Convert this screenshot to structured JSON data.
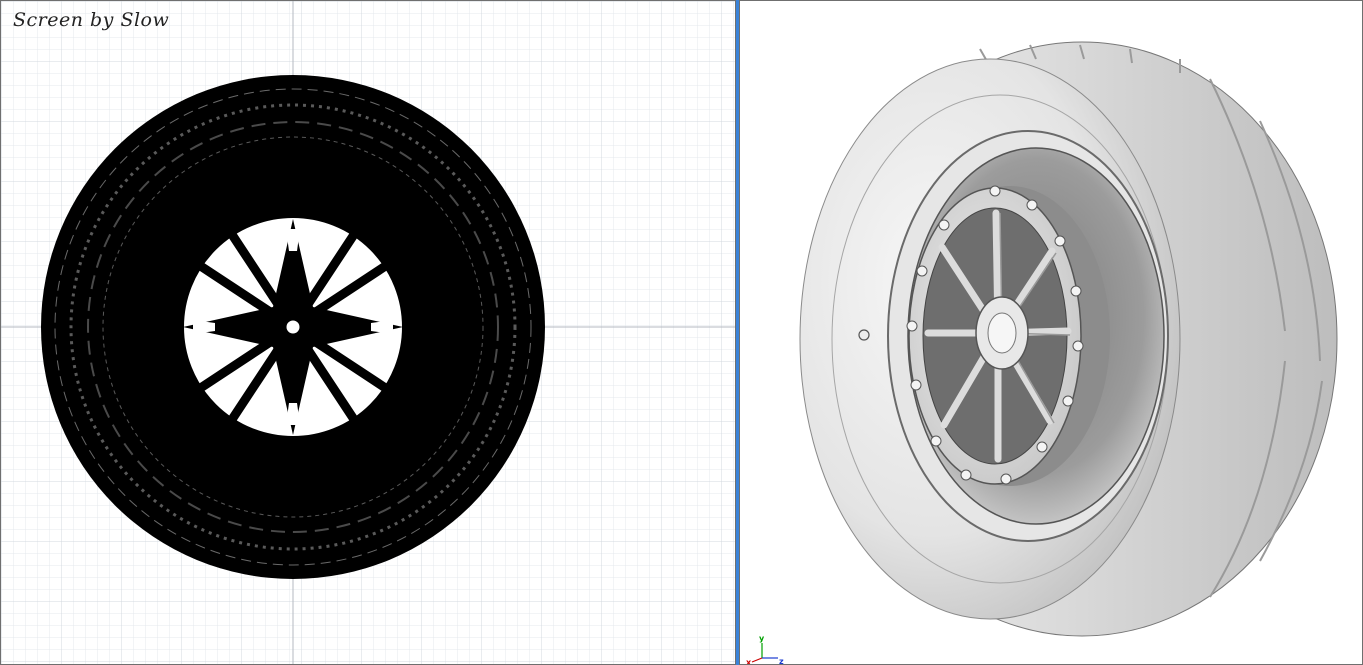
{
  "viewports": {
    "left": {
      "mode": "wireframe",
      "watermark": "Screen by Slow",
      "grid": true
    },
    "right": {
      "mode": "shaded"
    }
  },
  "axis_gizmo": {
    "x": "x",
    "y": "y",
    "z": "z"
  },
  "colors": {
    "grid_minor": "#e4e8ee",
    "grid_major": "#c9ced6",
    "wireframe": "#000000",
    "splitter": "#3a83d9",
    "axis_x": "#cc0000",
    "axis_y": "#00a000",
    "axis_z": "#1a3ad0"
  },
  "icons": [
    "axis-gizmo-icon"
  ]
}
